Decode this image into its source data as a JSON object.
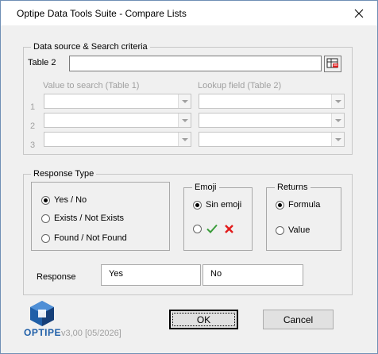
{
  "window": {
    "title": "Optipe Data Tools Suite - Compare Lists"
  },
  "data_source": {
    "legend": "Data source & Search criteria",
    "table2_label": "Table 2",
    "table2_value": "",
    "col1_header": "Value to search (Table 1)",
    "col2_header": "Lookup field (Table 2)",
    "row_numbers": [
      "1",
      "2",
      "3"
    ]
  },
  "response_type": {
    "legend": "Response Type",
    "options": [
      "Yes / No",
      "Exists / Not Exists",
      "Found / Not Found"
    ],
    "selected": "Yes / No",
    "emoji": {
      "legend": "Emoji",
      "option_text": "Sin emoji",
      "selected": "Sin emoji"
    },
    "returns": {
      "legend": "Returns",
      "options": [
        "Formula",
        "Value"
      ],
      "selected": "Formula"
    },
    "response_label": "Response",
    "response_true": "Yes",
    "response_false": "No"
  },
  "footer": {
    "logo_text": "OPTIPE",
    "version": "v3,00 [05/2026]",
    "ok_label": "OK",
    "cancel_label": "Cancel"
  },
  "colors": {
    "check": "#3a9c3a",
    "cross": "#e21b1b",
    "logo_blue": "#1f5fa8"
  }
}
